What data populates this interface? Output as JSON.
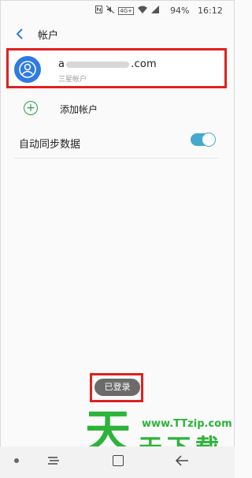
{
  "status_bar": {
    "battery": "94%",
    "time": "16:12",
    "nfc_icon": "nfc-icon",
    "network_label": "4G+"
  },
  "header": {
    "title": "帐户"
  },
  "account": {
    "email_start": "a",
    "email_end": ".com",
    "type": "三星帐户"
  },
  "add_account": {
    "label": "添加帐户"
  },
  "sync": {
    "label": "自动同步数据",
    "enabled": true
  },
  "toast": {
    "text": "已登录"
  },
  "watermark": {
    "big": "天",
    "url": "www.TTzip.com",
    "chars": "天下载"
  },
  "colors": {
    "accent": "#2e7be2",
    "toggle": "#45a9cf",
    "highlight": "#e02020",
    "watermark": "#2db33a"
  }
}
